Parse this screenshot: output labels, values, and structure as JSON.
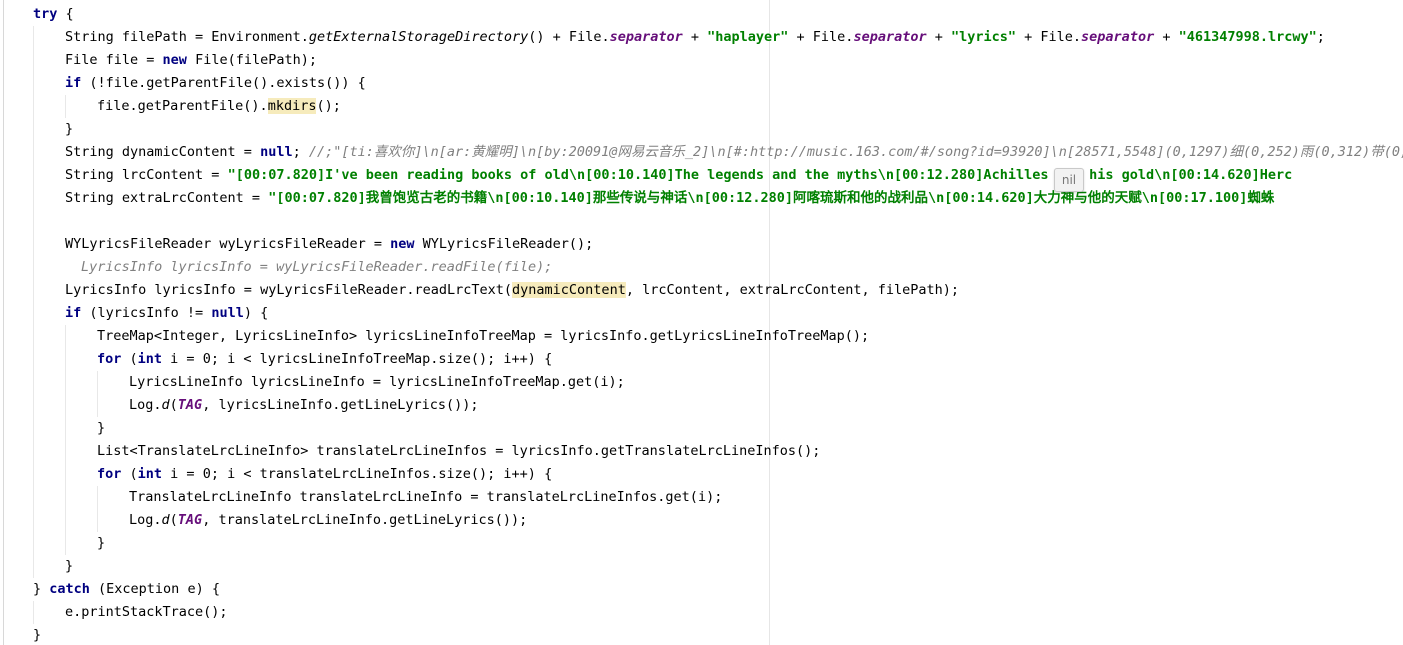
{
  "editor": {
    "lines": [
      {
        "indent": 0,
        "tokens": [
          {
            "t": "kw",
            "v": "try"
          },
          {
            "t": "plain",
            "v": " {"
          }
        ]
      },
      {
        "indent": 1,
        "tokens": [
          {
            "t": "plain",
            "v": "String filePath = Environment."
          },
          {
            "t": "static-m",
            "v": "getExternalStorageDirectory"
          },
          {
            "t": "plain",
            "v": "() + File."
          },
          {
            "t": "field",
            "v": "separator"
          },
          {
            "t": "plain",
            "v": " + "
          },
          {
            "t": "str",
            "v": "\"haplayer\""
          },
          {
            "t": "plain",
            "v": " + File."
          },
          {
            "t": "field",
            "v": "separator"
          },
          {
            "t": "plain",
            "v": " + "
          },
          {
            "t": "str",
            "v": "\"lyrics\""
          },
          {
            "t": "plain",
            "v": " + File."
          },
          {
            "t": "field",
            "v": "separator"
          },
          {
            "t": "plain",
            "v": " + "
          },
          {
            "t": "str",
            "v": "\"461347998.lrcwy\""
          },
          {
            "t": "plain",
            "v": ";"
          }
        ]
      },
      {
        "indent": 1,
        "tokens": [
          {
            "t": "plain",
            "v": "File file = "
          },
          {
            "t": "kw",
            "v": "new"
          },
          {
            "t": "plain",
            "v": " File(filePath);"
          }
        ]
      },
      {
        "indent": 1,
        "tokens": [
          {
            "t": "kw",
            "v": "if"
          },
          {
            "t": "plain",
            "v": " (!file.getParentFile().exists()) {"
          }
        ]
      },
      {
        "indent": 2,
        "tokens": [
          {
            "t": "plain",
            "v": "file.getParentFile()."
          },
          {
            "t": "hl",
            "v": "mkdirs"
          },
          {
            "t": "plain",
            "v": "();"
          }
        ]
      },
      {
        "indent": 1,
        "tokens": [
          {
            "t": "plain",
            "v": "}"
          }
        ]
      },
      {
        "indent": 1,
        "tokens": [
          {
            "t": "plain",
            "v": "String dynamicContent = "
          },
          {
            "t": "kw",
            "v": "null"
          },
          {
            "t": "plain",
            "v": "; "
          },
          {
            "t": "cmt",
            "v": "//;\"[ti:喜欢你]\\n[ar:黄耀明]\\n[by:20091@网易云音乐_2]\\n[#:http://music.163.com/#/song?id=93920]\\n[28571,5548](0,1297)细(0,252)雨(0,312)带(0,"
          }
        ]
      },
      {
        "indent": 1,
        "tokens": [
          {
            "t": "plain",
            "v": "String lrcContent = "
          },
          {
            "t": "str",
            "v": "\"[00:07.820]I've been reading books of old\\n[00:10.140]The legends and the myths\\n[00:12.280]Achilles and his gold\\n[00:14.620]Herc"
          }
        ]
      },
      {
        "indent": 1,
        "tokens": [
          {
            "t": "plain",
            "v": "String extraLrcContent = "
          },
          {
            "t": "str",
            "v": "\"[00:07.820]我曾饱览古老的书籍\\n[00:10.140]那些传说与神话\\n[00:12.280]阿喀琉斯和他的战利品\\n[00:14.620]大力神与他的天赋\\n[00:17.100]蜘蛛"
          }
        ]
      },
      {
        "indent": 0,
        "tokens": []
      },
      {
        "indent": 1,
        "tokens": [
          {
            "t": "plain",
            "v": "WYLyricsFileReader wyLyricsFileReader = "
          },
          {
            "t": "kw",
            "v": "new"
          },
          {
            "t": "plain",
            "v": " WYLyricsFileReader();"
          }
        ]
      },
      {
        "indent": 1,
        "extra": 16,
        "tokens": [
          {
            "t": "cmt",
            "v": "LyricsInfo lyricsInfo = wyLyricsFileReader.readFile(file);"
          }
        ]
      },
      {
        "indent": 1,
        "tokens": [
          {
            "t": "plain",
            "v": "LyricsInfo lyricsInfo = wyLyricsFileReader.readLrcText("
          },
          {
            "t": "hl",
            "v": "dynamicContent"
          },
          {
            "t": "plain",
            "v": ", lrcContent, extraLrcContent, filePath);"
          }
        ]
      },
      {
        "indent": 1,
        "tokens": [
          {
            "t": "kw",
            "v": "if"
          },
          {
            "t": "plain",
            "v": " (lyricsInfo != "
          },
          {
            "t": "kw",
            "v": "null"
          },
          {
            "t": "plain",
            "v": ") {"
          }
        ]
      },
      {
        "indent": 2,
        "tokens": [
          {
            "t": "plain",
            "v": "TreeMap<Integer, LyricsLineInfo> lyricsLineInfoTreeMap = lyricsInfo.getLyricsLineInfoTreeMap();"
          }
        ]
      },
      {
        "indent": 2,
        "tokens": [
          {
            "t": "kw",
            "v": "for"
          },
          {
            "t": "plain",
            "v": " ("
          },
          {
            "t": "kw",
            "v": "int"
          },
          {
            "t": "plain",
            "v": " i = "
          },
          {
            "t": "num",
            "v": "0"
          },
          {
            "t": "plain",
            "v": "; i < lyricsLineInfoTreeMap.size(); i++) {"
          }
        ]
      },
      {
        "indent": 3,
        "tokens": [
          {
            "t": "plain",
            "v": "LyricsLineInfo lyricsLineInfo = lyricsLineInfoTreeMap.get(i);"
          }
        ]
      },
      {
        "indent": 3,
        "tokens": [
          {
            "t": "plain",
            "v": "Log."
          },
          {
            "t": "static-m",
            "v": "d"
          },
          {
            "t": "plain",
            "v": "("
          },
          {
            "t": "field",
            "v": "TAG"
          },
          {
            "t": "plain",
            "v": ", lyricsLineInfo.getLineLyrics());"
          }
        ]
      },
      {
        "indent": 2,
        "tokens": [
          {
            "t": "plain",
            "v": "}"
          }
        ]
      },
      {
        "indent": 2,
        "tokens": [
          {
            "t": "plain",
            "v": "List<TranslateLrcLineInfo> translateLrcLineInfos = lyricsInfo.getTranslateLrcLineInfos();"
          }
        ]
      },
      {
        "indent": 2,
        "tokens": [
          {
            "t": "kw",
            "v": "for"
          },
          {
            "t": "plain",
            "v": " ("
          },
          {
            "t": "kw",
            "v": "int"
          },
          {
            "t": "plain",
            "v": " i = "
          },
          {
            "t": "num",
            "v": "0"
          },
          {
            "t": "plain",
            "v": "; i < translateLrcLineInfos.size(); i++) {"
          }
        ]
      },
      {
        "indent": 3,
        "tokens": [
          {
            "t": "plain",
            "v": "TranslateLrcLineInfo translateLrcLineInfo = translateLrcLineInfos.get(i);"
          }
        ]
      },
      {
        "indent": 3,
        "tokens": [
          {
            "t": "plain",
            "v": "Log."
          },
          {
            "t": "static-m",
            "v": "d"
          },
          {
            "t": "plain",
            "v": "("
          },
          {
            "t": "field",
            "v": "TAG"
          },
          {
            "t": "plain",
            "v": ", translateLrcLineInfo.getLineLyrics());"
          }
        ]
      },
      {
        "indent": 2,
        "tokens": [
          {
            "t": "plain",
            "v": "}"
          }
        ]
      },
      {
        "indent": 1,
        "tokens": [
          {
            "t": "plain",
            "v": "}"
          }
        ]
      },
      {
        "indent": 0,
        "tokens": [
          {
            "t": "plain",
            "v": "} "
          },
          {
            "t": "kw",
            "v": "catch"
          },
          {
            "t": "plain",
            "v": " (Exception e) {"
          }
        ]
      },
      {
        "indent": 1,
        "tokens": [
          {
            "t": "plain",
            "v": "e.printStackTrace();"
          }
        ]
      },
      {
        "indent": 0,
        "tokens": [
          {
            "t": "plain",
            "v": "}"
          }
        ]
      }
    ],
    "inlay_hint": "nil"
  },
  "colors": {
    "keyword": "#000080",
    "string": "#008000",
    "field": "#660e7a",
    "comment": "#808080",
    "highlight": "#f6ebbc"
  }
}
